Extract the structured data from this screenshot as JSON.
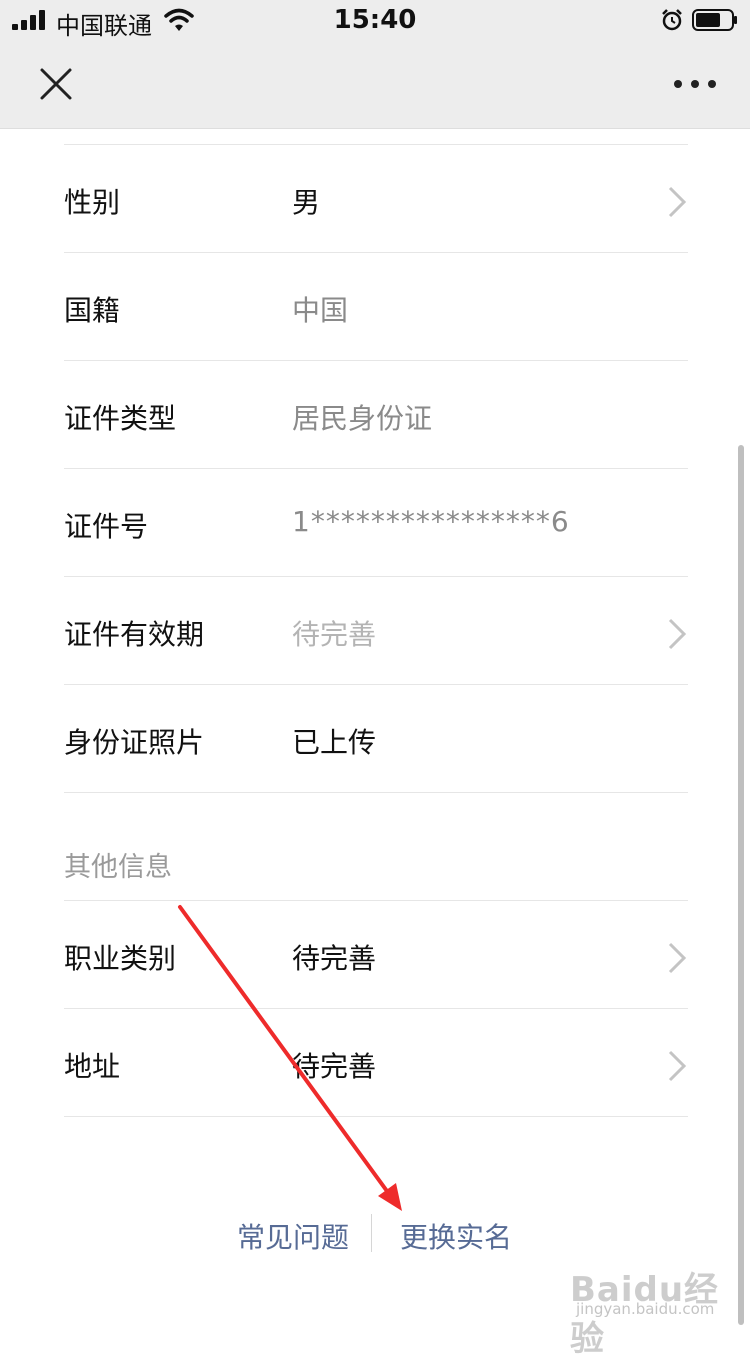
{
  "status_bar": {
    "carrier": "中国联通",
    "time": "15:40"
  },
  "fields": [
    {
      "label": "性别",
      "value": "男",
      "value_color": "#111111",
      "chevron": true
    },
    {
      "label": "国籍",
      "value": "中国",
      "value_color": "#8a8a8a",
      "chevron": false
    },
    {
      "label": "证件类型",
      "value": "居民身份证",
      "value_color": "#8a8a8a",
      "chevron": false
    },
    {
      "label": "证件号",
      "value": "1****************6",
      "value_color": "#8a8a8a",
      "chevron": false
    },
    {
      "label": "证件有效期",
      "value": "待完善",
      "value_color": "#b4b4b4",
      "chevron": true
    },
    {
      "label": "身份证照片",
      "value": "已上传",
      "value_color": "#111111",
      "chevron": false
    }
  ],
  "other_section": {
    "title": "其他信息",
    "fields": [
      {
        "label": "职业类别",
        "value": "待完善",
        "value_color": "#111111",
        "chevron": true
      },
      {
        "label": "地址",
        "value": "待完善",
        "value_color": "#111111",
        "chevron": true
      }
    ]
  },
  "footer": {
    "faq": "常见问题",
    "change_real_name": "更换实名"
  },
  "colors": {
    "link": "#576b95",
    "annotation_arrow": "#ee2b2b",
    "nav_background": "#ededed"
  },
  "watermark": {
    "brand": "Baidu经验",
    "url": "jingyan.baidu.com"
  }
}
